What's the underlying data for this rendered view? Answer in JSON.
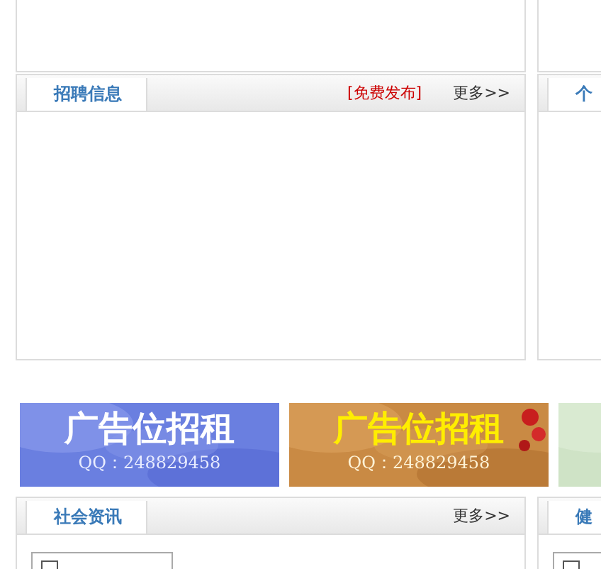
{
  "recruit_row": [
    {
      "title": "招聘信息",
      "publish_link": "[免费发布]",
      "more": "更多>>"
    },
    {
      "title": "个"
    }
  ],
  "banners": [
    {
      "kind": "ad",
      "headline": "广告位招租",
      "contact": "QQ：248829458"
    },
    {
      "kind": "ad",
      "headline": "广告位招租",
      "contact": "QQ：248829458"
    },
    {
      "kind": "picture"
    }
  ],
  "news_row": [
    {
      "title": "社会资讯",
      "more": "更多>>",
      "has_image": true
    },
    {
      "title": "健",
      "has_image": true
    }
  ]
}
